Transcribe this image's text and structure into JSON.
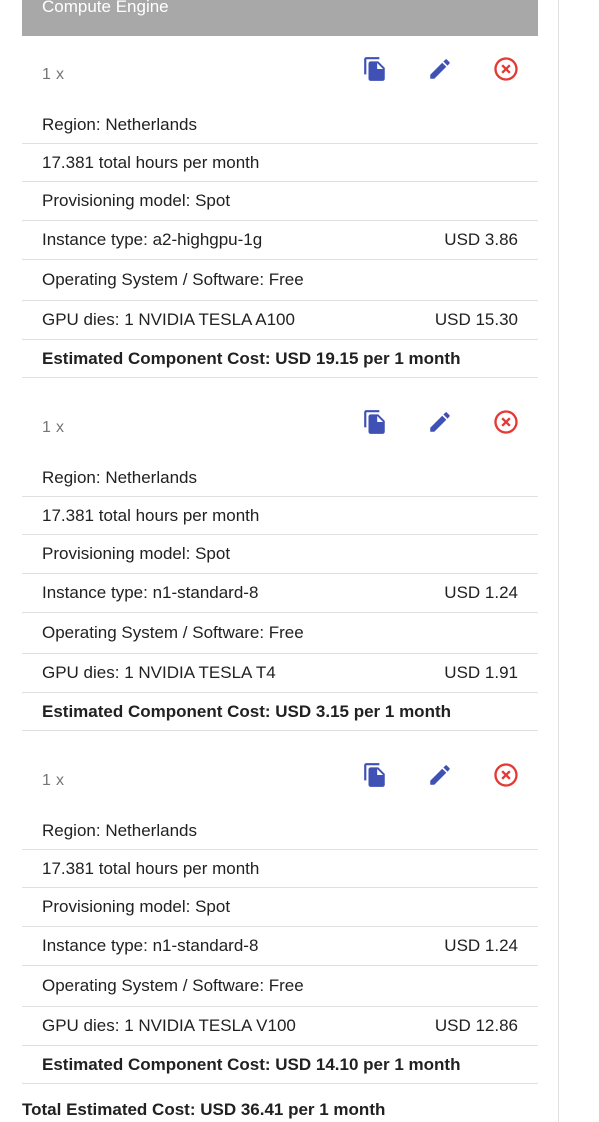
{
  "section_title": "Compute Engine",
  "items": [
    {
      "qty": "1 x",
      "rows": [
        {
          "label": "Region: Netherlands",
          "price": ""
        },
        {
          "label": "17.381 total hours per month",
          "price": ""
        },
        {
          "label": "Provisioning model: Spot",
          "price": ""
        },
        {
          "label": "Instance type: a2-highgpu-1g",
          "price": "USD 3.86"
        },
        {
          "label": "Operating System / Software: Free",
          "price": ""
        },
        {
          "label": "GPU dies: 1 NVIDIA TESLA A100",
          "price": "USD 15.30"
        }
      ],
      "estimated": "Estimated Component Cost: USD 19.15 per 1 month"
    },
    {
      "qty": "1 x",
      "rows": [
        {
          "label": "Region: Netherlands",
          "price": ""
        },
        {
          "label": "17.381 total hours per month",
          "price": ""
        },
        {
          "label": "Provisioning model: Spot",
          "price": ""
        },
        {
          "label": "Instance type: n1-standard-8",
          "price": "USD 1.24"
        },
        {
          "label": "Operating System / Software: Free",
          "price": ""
        },
        {
          "label": "GPU dies: 1 NVIDIA TESLA T4",
          "price": "USD 1.91"
        }
      ],
      "estimated": "Estimated Component Cost: USD 3.15 per 1 month"
    },
    {
      "qty": "1 x",
      "rows": [
        {
          "label": "Region: Netherlands",
          "price": ""
        },
        {
          "label": "17.381 total hours per month",
          "price": ""
        },
        {
          "label": "Provisioning model: Spot",
          "price": ""
        },
        {
          "label": "Instance type: n1-standard-8",
          "price": "USD 1.24"
        },
        {
          "label": "Operating System / Software: Free",
          "price": ""
        },
        {
          "label": "GPU dies: 1 NVIDIA TESLA V100",
          "price": "USD 12.86"
        }
      ],
      "estimated": "Estimated Component Cost: USD 14.10 per 1 month"
    }
  ],
  "total": "Total Estimated Cost: USD 36.41 per 1 month",
  "colors": {
    "action_blue": "#3f51b5",
    "delete_red": "#e53935",
    "header_gray": "#a8a8a8"
  },
  "icons": {
    "copy": "copy-icon",
    "edit": "edit-icon",
    "delete": "delete-icon"
  }
}
